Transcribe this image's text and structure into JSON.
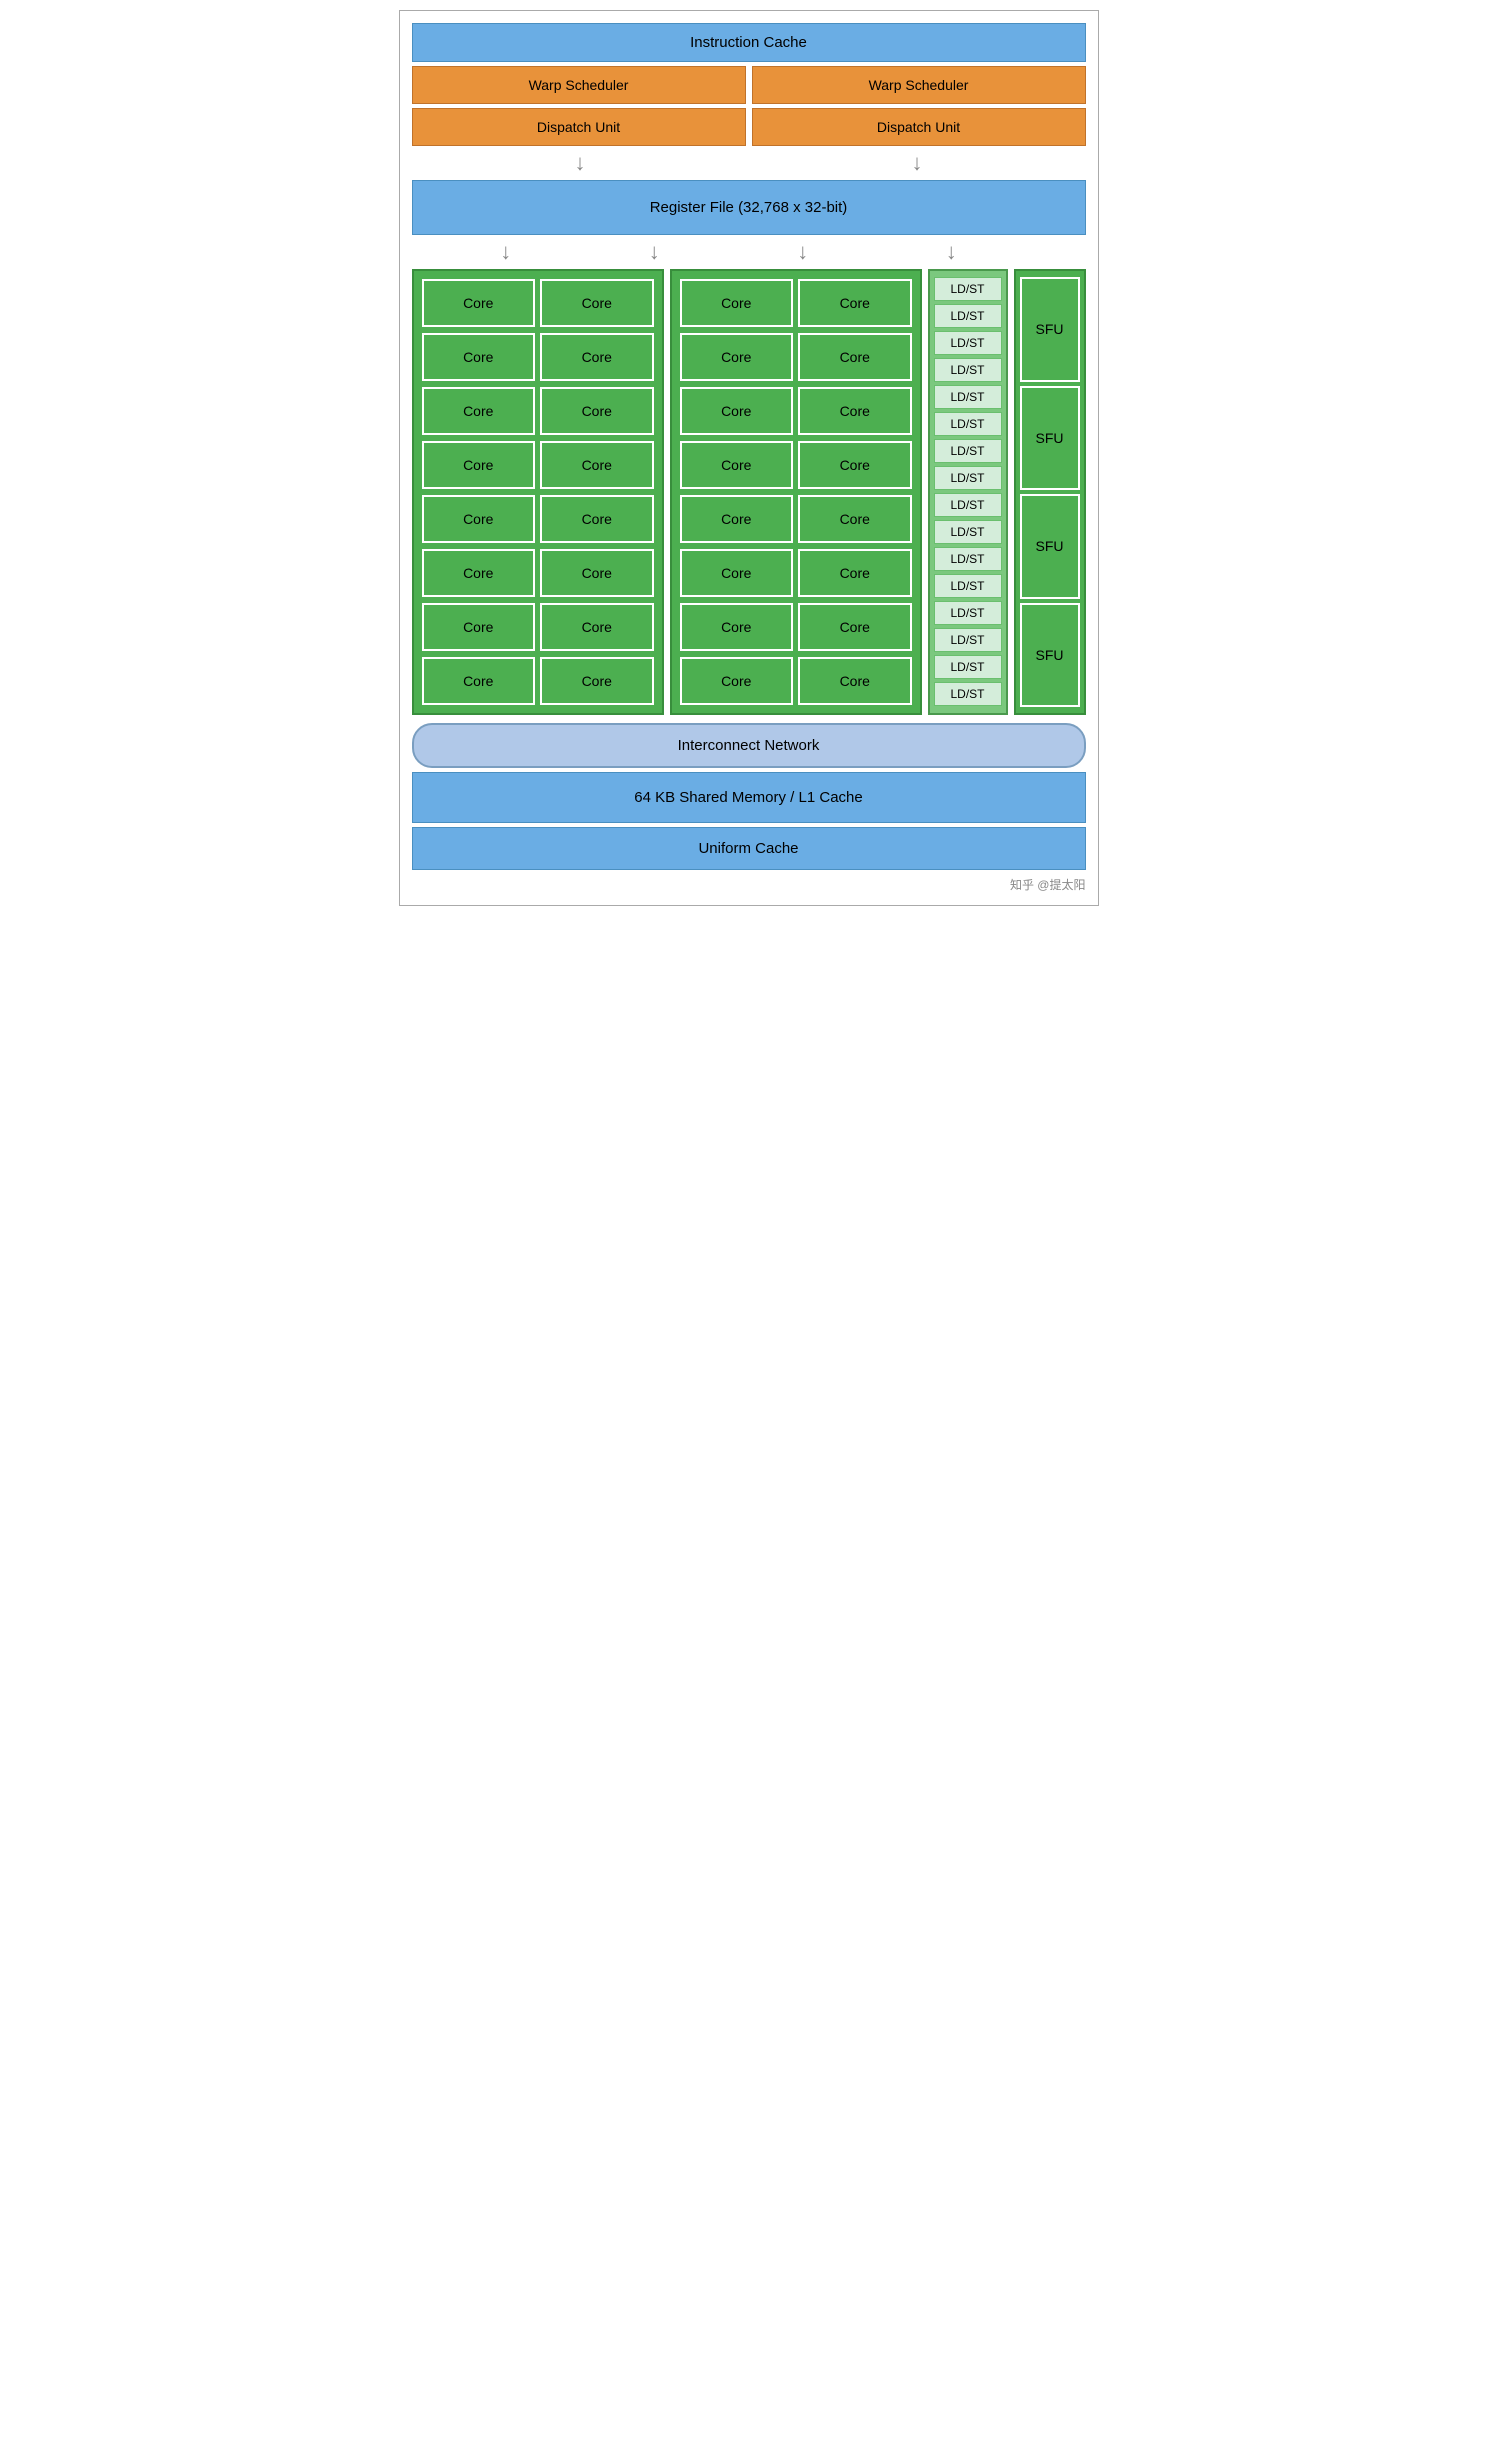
{
  "header": {
    "instruction_cache": "Instruction Cache"
  },
  "warp_schedulers": [
    "Warp Scheduler",
    "Warp Scheduler"
  ],
  "dispatch_units": [
    "Dispatch Unit",
    "Dispatch Unit"
  ],
  "register_file": "Register File (32,768 x 32-bit)",
  "cores": {
    "col1_rows": [
      [
        "Core",
        "Core"
      ],
      [
        "Core",
        "Core"
      ],
      [
        "Core",
        "Core"
      ],
      [
        "Core",
        "Core"
      ],
      [
        "Core",
        "Core"
      ],
      [
        "Core",
        "Core"
      ],
      [
        "Core",
        "Core"
      ],
      [
        "Core",
        "Core"
      ]
    ],
    "col2_rows": [
      [
        "Core",
        "Core"
      ],
      [
        "Core",
        "Core"
      ],
      [
        "Core",
        "Core"
      ],
      [
        "Core",
        "Core"
      ],
      [
        "Core",
        "Core"
      ],
      [
        "Core",
        "Core"
      ],
      [
        "Core",
        "Core"
      ],
      [
        "Core",
        "Core"
      ]
    ]
  },
  "ldst_units": [
    "LD/ST",
    "LD/ST",
    "LD/ST",
    "LD/ST",
    "LD/ST",
    "LD/ST",
    "LD/ST",
    "LD/ST",
    "LD/ST",
    "LD/ST",
    "LD/ST",
    "LD/ST",
    "LD/ST",
    "LD/ST",
    "LD/ST",
    "LD/ST"
  ],
  "sfu_units": [
    "SFU",
    "SFU",
    "SFU",
    "SFU"
  ],
  "interconnect": "Interconnect Network",
  "shared_memory": "64 KB Shared Memory / L1 Cache",
  "uniform_cache": "Uniform Cache",
  "watermark": "知乎 @提太阳"
}
